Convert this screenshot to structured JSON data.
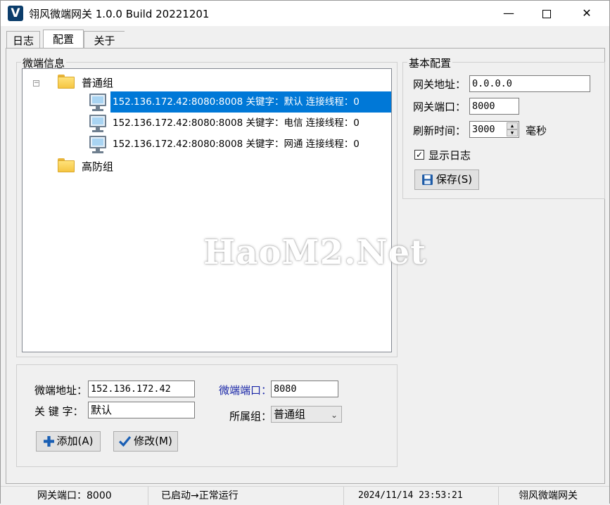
{
  "window": {
    "title": "翎风微端网关 1.0.0 Build 20221201",
    "icon_letter": "V"
  },
  "titlebar": {
    "minimize_icon": "minimize-icon",
    "maximize_icon": "maximize-icon",
    "close_icon": "close-icon",
    "close_glyph": "✕",
    "min_glyph": "—"
  },
  "tabs": [
    {
      "label": "日志"
    },
    {
      "label": "配置"
    },
    {
      "label": "关于"
    }
  ],
  "micro_info": {
    "title": "微端信息",
    "expander": "⊟",
    "groups": [
      {
        "name": "普通组",
        "nodes": [
          {
            "text": "152.136.172.42:8080:8008 关键字：默认 连接线程：0",
            "selected": true
          },
          {
            "text": "152.136.172.42:8080:8008 关键字：电信 连接线程：0",
            "selected": false
          },
          {
            "text": "152.136.172.42:8080:8008 关键字：网通 连接线程：0",
            "selected": false
          }
        ]
      },
      {
        "name": "高防组",
        "nodes": []
      }
    ]
  },
  "basic_config": {
    "title": "基本配置",
    "gateway_address_label": "网关地址：",
    "gateway_address_value": "0.0.0.0",
    "gateway_port_label": "网关端口：",
    "gateway_port_value": "8000",
    "refresh_label": "刷新时间：",
    "refresh_value": "3000",
    "refresh_unit": "毫秒",
    "show_log_label": "显示日志",
    "show_log_checked": true,
    "save_label": "保存(S)"
  },
  "form": {
    "address_label": "微端地址：",
    "address_value": "152.136.172.42",
    "keyword_label": "关 键 字：",
    "keyword_value": "默认",
    "port_label": "微端端口：",
    "port_value": "8080",
    "group_label": "所属组：",
    "group_value": "普通组",
    "add_label": "添加(A)",
    "modify_label": "修改(M)"
  },
  "watermark": "HaoM2.Net",
  "statusbar": {
    "gateway_port": "网关端口：8000",
    "status": "已启动→正常运行",
    "datetime": "2024/11/14 23:53:21",
    "app_name": "翎风微端网关"
  },
  "colors": {
    "selection": "#0078d7",
    "blue_label": "#1a27a8",
    "folder": "#f5c542"
  }
}
